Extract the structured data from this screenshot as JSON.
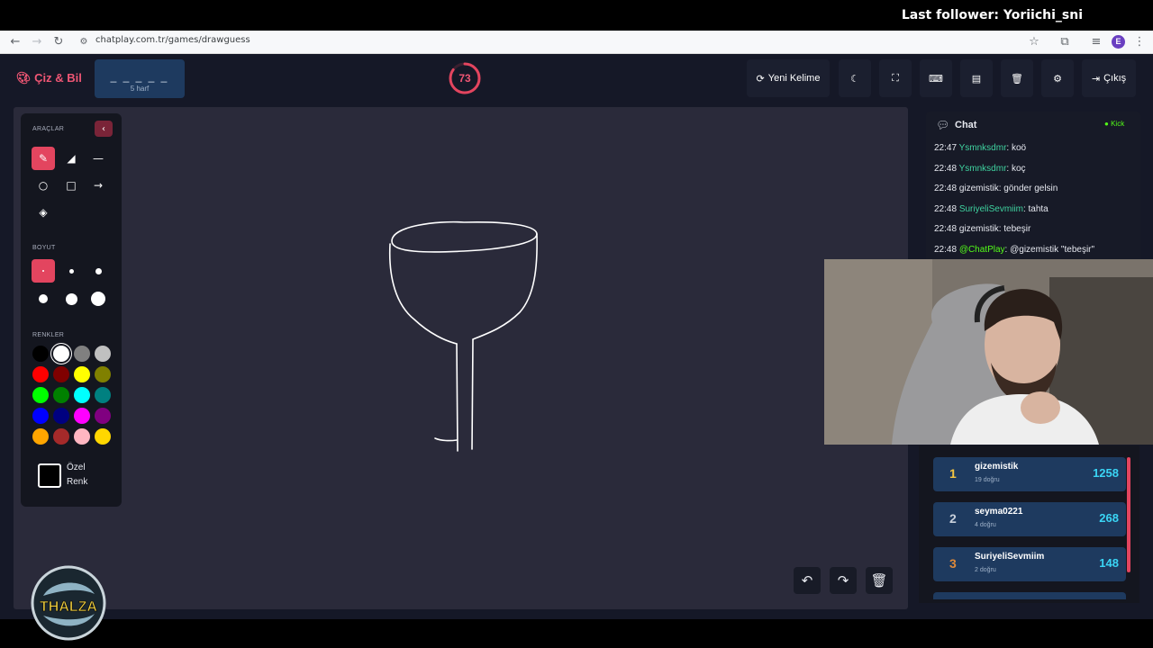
{
  "stream": {
    "last_follower": "Last follower: Yoriichi_sni"
  },
  "browser": {
    "url": "chatplay.com.tr/games/drawguess",
    "profile_initial": "E"
  },
  "header": {
    "logo": "Çiz & Bil",
    "word_mask": "_ _ _ _ _",
    "word_hint": "5 harf",
    "timer": "73",
    "timer_fraction": 0.85,
    "new_word": "Yeni Kelime",
    "exit": "Çıkış"
  },
  "toolbar": {
    "tools_label": "ARAÇLAR",
    "size_label": "BOYUT",
    "colors_label": "RENKLER",
    "custom_color_line1": "Özel",
    "custom_color_line2": "Renk",
    "colors": [
      "#000000",
      "#ffffff",
      "#808080",
      "#c0c0c0",
      "#ff0000",
      "#800000",
      "#ffff00",
      "#808000",
      "#00ff00",
      "#008000",
      "#00ffff",
      "#008080",
      "#0000ff",
      "#000080",
      "#ff00ff",
      "#800080",
      "#ffa500",
      "#a52a2a",
      "#ffb6c1",
      "#ffd700"
    ]
  },
  "chat": {
    "title": "Chat",
    "platform": "Kick",
    "messages": [
      {
        "time": "22:47",
        "user": "Ysmnksdmr",
        "text": ": koö",
        "user_color": "#3fd3a0"
      },
      {
        "time": "22:48",
        "user": "Ysmnksdmr",
        "text": ": koç",
        "user_color": "#3fd3a0"
      },
      {
        "time": "22:48",
        "user": "gizemistik",
        "text": ": gönder gelsin",
        "user_color": "#e6e8ef"
      },
      {
        "time": "22:48",
        "user": "SuriyeliSevmiim",
        "text": ": tahta",
        "user_color": "#3fd3a0"
      },
      {
        "time": "22:48",
        "user": "gizemistik",
        "text": ": tebeşir",
        "user_color": "#e6e8ef"
      },
      {
        "time": "22:48",
        "user": "@ChatPlay",
        "text": ": @gizemistik \"tebeşir\"",
        "user_color": "#53fc18"
      }
    ]
  },
  "leaderboard": [
    {
      "rank": "1",
      "name": "gizemistik",
      "correct": "19 doğru",
      "score": "1258",
      "rank_color": "#f4c542"
    },
    {
      "rank": "2",
      "name": "seyma0221",
      "correct": "4 doğru",
      "score": "268",
      "rank_color": "#c9d1dc"
    },
    {
      "rank": "3",
      "name": "SuriyeliSevmiim",
      "correct": "2 doğru",
      "score": "148",
      "rank_color": "#e08a3a"
    }
  ],
  "channel": {
    "logo_text": "THALZA"
  }
}
